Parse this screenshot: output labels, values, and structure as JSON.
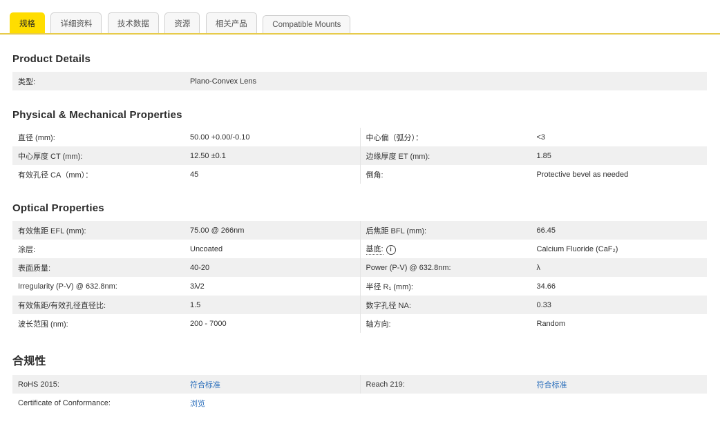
{
  "tabs": {
    "specifications": "规格",
    "details": "详细资料",
    "technical": "技术数据",
    "resources": "资源",
    "related": "相关产品",
    "mounts": "Compatible Mounts"
  },
  "colors": {
    "active_tab_yellow": "#ffdd00",
    "tab_underline": "#e7cb4b",
    "row_stripe_gray": "#f0f0f0",
    "link_blue": "#2a6ebb"
  },
  "product_details": {
    "heading": "Product Details",
    "type_label": "类型:",
    "type_value": "Plano-Convex Lens"
  },
  "physical": {
    "heading": "Physical & Mechanical Properties",
    "rows": [
      {
        "l_label": "直径 (mm):",
        "l_value": "50.00 +0.00/-0.10",
        "r_label": "中心偏（弧分）：",
        "r_value": "<3"
      },
      {
        "l_label": "中心厚度 CT (mm):",
        "l_value": "12.50 ±0.1",
        "r_label": "边缘厚度 ET (mm):",
        "r_value": "1.85"
      },
      {
        "l_label": "有效孔径 CA（mm）：",
        "l_value": "45",
        "r_label": "倒角:",
        "r_value": "Protective bevel as needed"
      }
    ]
  },
  "optical": {
    "heading": "Optical Properties",
    "rows": [
      {
        "l_label": "有效焦距 EFL (mm):",
        "l_value": "75.00 @ 266nm",
        "r_label": "后焦距 BFL (mm):",
        "r_value": "66.45"
      },
      {
        "l_label": "涂层:",
        "l_value": "Uncoated",
        "r_label": "基底:",
        "r_info": "i",
        "r_value": "Calcium Fluoride (CaF₂)"
      },
      {
        "l_label": "表面质量:",
        "l_value": "40-20",
        "r_label": "Power (P-V) @ 632.8nm:",
        "r_value": "λ"
      },
      {
        "l_label": "Irregularity (P-V) @ 632.8nm:",
        "l_value": "3λ/2",
        "r_label": "半径 R₁ (mm):",
        "r_value": "34.66"
      },
      {
        "l_label": "有效焦距/有效孔径直径比:",
        "l_value": "1.5",
        "r_label": "数字孔径 NA:",
        "r_value": "0.33"
      },
      {
        "l_label": "波长范围 (nm):",
        "l_value": "200 - 7000",
        "r_label": "轴方向:",
        "r_value": "Random"
      }
    ]
  },
  "compliance": {
    "heading": "合规性",
    "rohs_label": "RoHS 2015:",
    "rohs_link": "符合标准",
    "reach_label": "Reach 219:",
    "reach_link": "符合标准",
    "coc_label": "Certificate of Conformance:",
    "coc_link": "浏览"
  }
}
